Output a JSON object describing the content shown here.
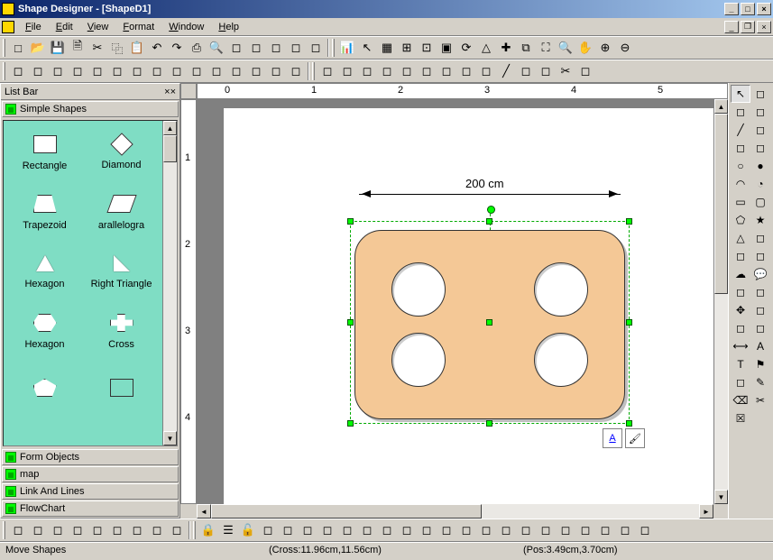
{
  "title": "Shape Designer - [ShapeD1]",
  "menu": [
    "File",
    "Edit",
    "View",
    "Format",
    "Window",
    "Help"
  ],
  "listbar": {
    "title": "List Bar",
    "active_category": "Simple Shapes",
    "shapes": [
      {
        "label": "Rectangle",
        "ico": "rect"
      },
      {
        "label": "Diamond",
        "ico": "diamond"
      },
      {
        "label": "Trapezoid",
        "ico": "trap"
      },
      {
        "label": "arallelogra",
        "ico": "para"
      },
      {
        "label": "Hexagon",
        "ico": "tri"
      },
      {
        "label": "Right Triangle",
        "ico": "rtri"
      },
      {
        "label": "Hexagon",
        "ico": "hex"
      },
      {
        "label": "Cross",
        "ico": "cross"
      },
      {
        "label": "",
        "ico": "pent"
      },
      {
        "label": "",
        "ico": "cube"
      }
    ],
    "categories": [
      "Form Objects",
      "map",
      "Link And Lines",
      "FlowChart"
    ]
  },
  "ruler_h": [
    "0",
    "1",
    "2",
    "3",
    "4",
    "5"
  ],
  "ruler_v": [
    "1",
    "2",
    "3",
    "4"
  ],
  "dimension": "200 cm",
  "status": {
    "mode": "Move Shapes",
    "cross": "(Cross:11.96cm,11.56cm)",
    "pos": "(Pos:3.49cm,3.70cm)"
  },
  "toolbar1_icons": [
    "new",
    "open",
    "save",
    "saveall",
    "cut",
    "copy",
    "paste",
    "undo",
    "redo",
    "print",
    "preview",
    "copy2",
    "paste2",
    "shapeprops",
    "group",
    "ungroup"
  ],
  "toolbar1b_icons": [
    "chart",
    "select",
    "grid",
    "grid2",
    "snap",
    "sel-rect",
    "rotate",
    "tri",
    "cross",
    "crop",
    "zoom-fit",
    "zoom-sel",
    "pan",
    "zoom-in",
    "zoom-out"
  ],
  "toolbar2_icons": [
    "arrow",
    "a1",
    "a2",
    "a3",
    "a4",
    "a5",
    "a6",
    "a7",
    "a8",
    "a9",
    "a10",
    "a11",
    "a12",
    "a13",
    "a14"
  ],
  "toolbar2b_icons": [
    "c1",
    "c2",
    "c3",
    "c4",
    "c5",
    "c6",
    "c7",
    "arc1",
    "arc2",
    "line",
    "bez",
    "curve",
    "scissors",
    "paint"
  ],
  "toolbar3_icons": [
    "m1",
    "m2",
    "m3",
    "m4",
    "m5",
    "m6",
    "m7",
    "m8",
    "m9"
  ],
  "toolbar3b_icons": [
    "lock",
    "layer",
    "unlock",
    "align-l",
    "align-c",
    "align-r",
    "align-t",
    "align-m",
    "align-b",
    "dist-h",
    "dist-v",
    "same-w",
    "same-h",
    "same",
    "front",
    "back",
    "forward",
    "backward",
    "g1",
    "g2",
    "g3",
    "g4",
    "g5"
  ],
  "right_tools": [
    "pointer",
    "lasso",
    "cursor-add",
    "cursor-curve",
    "line",
    "line2",
    "polyline",
    "ray",
    "ellipse",
    "circle",
    "arc",
    "pie",
    "rect",
    "rrect",
    "poly",
    "star",
    "triangle",
    "curve2",
    "bezier",
    "spline",
    "cloud",
    "callout",
    "shadow",
    "fill",
    "move",
    "rotate2",
    "scale",
    "shear",
    "measure",
    "text-a",
    "text-t",
    "flag",
    "multi",
    "pencil",
    "erase",
    "scissors2",
    "x-box"
  ]
}
